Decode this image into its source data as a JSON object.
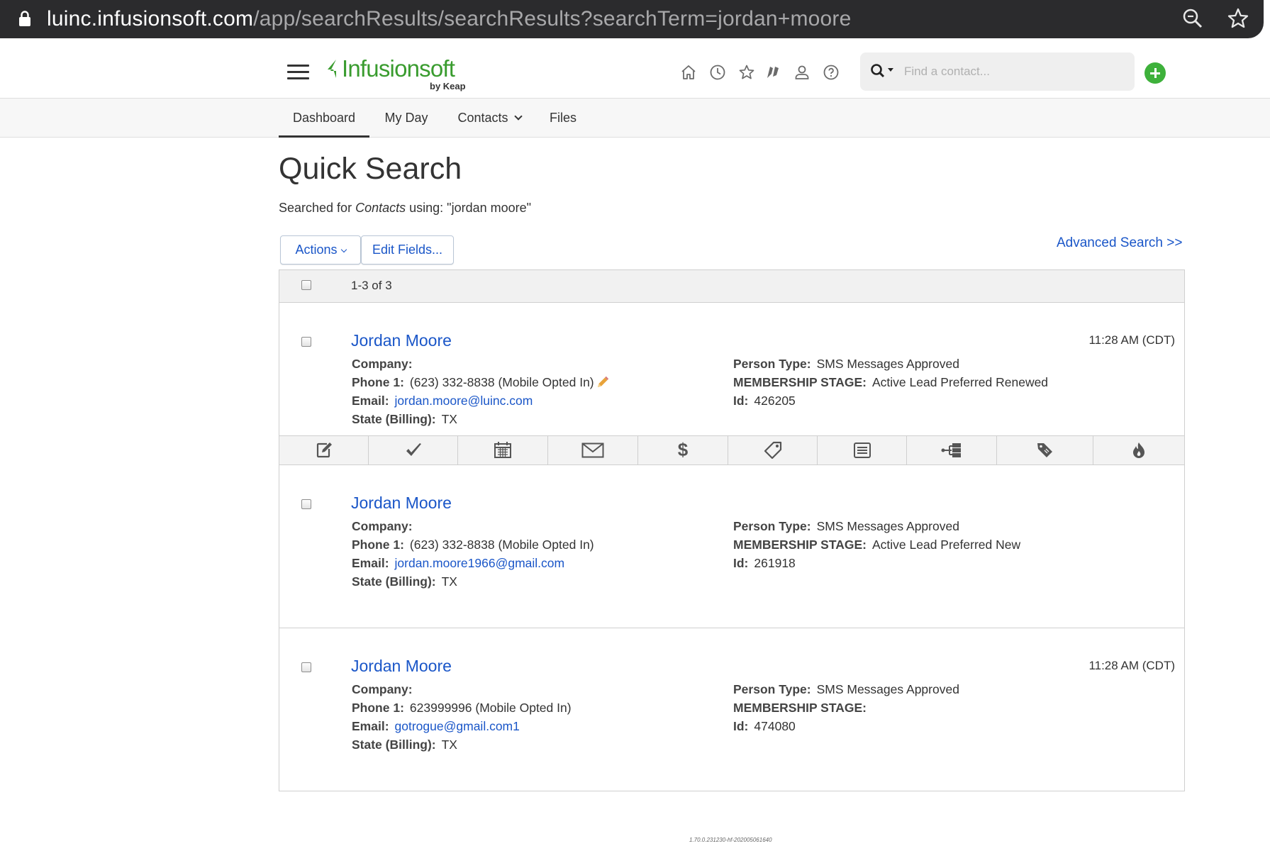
{
  "browser": {
    "url_host": "luinc.infusionsoft.com",
    "url_path": "/app/searchResults/searchResults?searchTerm=jordan+moore",
    "icons": [
      "lock-icon",
      "zoom-icon",
      "bookmark-star-icon"
    ]
  },
  "header": {
    "logo_text": "Infusionsoft",
    "logo_sub": "by Keap",
    "icons": [
      "home-icon",
      "history-icon",
      "favorites-icon",
      "flags-icon",
      "user-icon",
      "help-icon"
    ],
    "search_placeholder": "Find a contact...",
    "add_button_color": "#3eb13b"
  },
  "nav": {
    "tabs": [
      {
        "label": "Dashboard",
        "active": true
      },
      {
        "label": "My Day",
        "active": false
      },
      {
        "label": "Contacts",
        "active": false,
        "dropdown": true
      },
      {
        "label": "Files",
        "active": false
      }
    ]
  },
  "page": {
    "title": "Quick Search",
    "desc_prefix": "Searched for",
    "desc_entity": "Contacts",
    "desc_suffix": "using: \"jordan moore\"",
    "actions_label": "Actions",
    "edit_fields_label": "Edit Fields...",
    "advanced_search_label": "Advanced Search >>",
    "result_count": "1-3 of 3"
  },
  "labels": {
    "company": "Company:",
    "phone": "Phone 1:",
    "email": "Email:",
    "state": "State (Billing):",
    "person_type": "Person Type:",
    "membership": "MEMBERSHIP STAGE:",
    "id": "Id:"
  },
  "records": [
    {
      "name": "Jordan Moore",
      "time": "11:28 AM (CDT)",
      "company": "",
      "phone": "(623) 332-8838 (Mobile Opted In)",
      "email": "jordan.moore@luinc.com",
      "state": "TX",
      "person_type": "SMS Messages Approved",
      "membership_stage": "Active Lead Preferred Renewed",
      "id": "426205"
    },
    {
      "name": "Jordan Moore",
      "time": "",
      "company": "",
      "phone": "(623) 332-8838 (Mobile Opted In)",
      "email": "jordan.moore1966@gmail.com",
      "state": "TX",
      "person_type": "SMS Messages Approved",
      "membership_stage": "Active Lead Preferred New",
      "id": "261918"
    },
    {
      "name": "Jordan Moore",
      "time": "11:28 AM (CDT)",
      "company": "",
      "phone": "623999996 (Mobile Opted In)",
      "email": "gotrogue@gmail.com1",
      "state": "TX",
      "person_type": "SMS Messages Approved",
      "membership_stage": "",
      "id": "474080"
    }
  ],
  "action_icons": [
    "note-icon",
    "task-check-icon",
    "calendar-icon",
    "email-icon",
    "dollar-icon",
    "tag-icon",
    "form-icon",
    "sequence-icon",
    "tags-icon",
    "fire-icon"
  ],
  "footer": {
    "version": "1.70.0.231230-hf-202005061640"
  },
  "colors": {
    "link": "#1a56c8",
    "brand_green": "#3a9c2f"
  }
}
